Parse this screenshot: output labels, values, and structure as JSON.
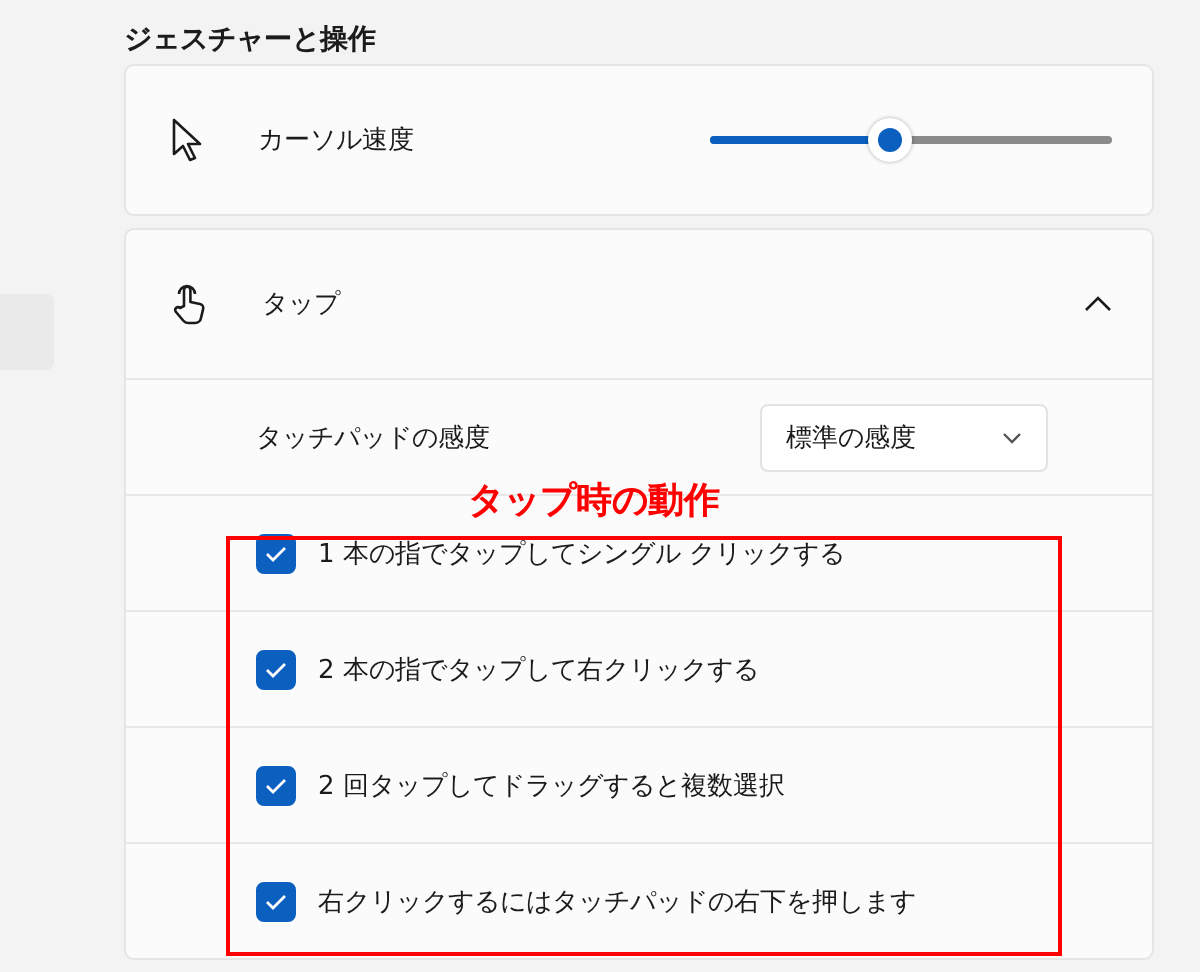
{
  "section_title": "ジェスチャーと操作",
  "cursor_speed": {
    "label": "カーソル速度",
    "level": 0.45
  },
  "tap": {
    "label": "タップ",
    "expanded": true,
    "sensitivity": {
      "label": "タッチパッドの感度",
      "value": "標準の感度"
    },
    "options": [
      {
        "label": "1 本の指でタップしてシングル クリックする",
        "checked": true
      },
      {
        "label": "2 本の指でタップして右クリックする",
        "checked": true
      },
      {
        "label": "2 回タップしてドラッグすると複数選択",
        "checked": true
      },
      {
        "label": "右クリックするにはタッチパッドの右下を押します",
        "checked": true
      }
    ]
  },
  "annotation": {
    "label": "タップ時の動作"
  }
}
